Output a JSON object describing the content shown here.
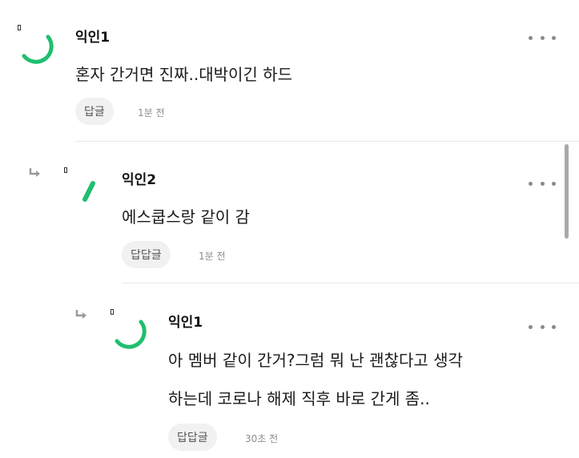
{
  "comments": [
    {
      "author": "익인1",
      "text_lines": [
        "혼자 간거면 진짜..대박이긴 하드"
      ],
      "reply_label": "답글",
      "time": "1분 전"
    },
    {
      "author": "익인2",
      "text_lines": [
        "에스쿱스랑 같이 감"
      ],
      "reply_label": "답답글",
      "time": "1분 전"
    },
    {
      "author": "익인1",
      "text_lines": [
        "아 멤버 같이 간거?그럼 뭐 난 괜찮다고 생각",
        "하는데 코로나 해제 직후 바로 간게 좀.."
      ],
      "reply_label": "답답글",
      "time": "30초 전"
    }
  ],
  "icons": {
    "avatar": "avatar-arc-icon",
    "reply_arrow": "reply-arrow-icon",
    "more": "more-dots-icon"
  },
  "colors": {
    "accent": "#1fbf6e",
    "muted": "#8d8d8d",
    "button_bg": "#f1f1f1"
  }
}
